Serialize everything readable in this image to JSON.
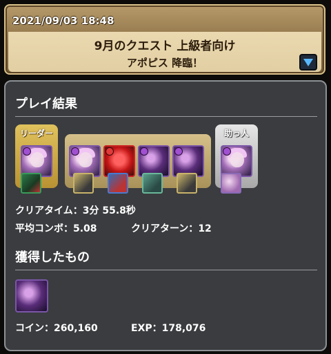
{
  "banner": {
    "datetime": "2021/09/03 18:48",
    "title": "9月のクエスト 上級者向け",
    "subtitle": "アポピス 降臨！"
  },
  "result": {
    "heading": "プレイ結果",
    "team": {
      "leader_label": "リーダー",
      "helper_label": "助っ人"
    },
    "clear_time_label": "クリアタイム：",
    "clear_time": "3分 55.8秒",
    "avg_combo_label": "平均コンボ：",
    "avg_combo": "5.08",
    "clear_turns_label": "クリアターン：",
    "clear_turns": "12"
  },
  "rewards": {
    "heading": "獲得したもの",
    "coin_label": "コイン：",
    "coin": "260,160",
    "exp_label": "EXP：",
    "exp": "178,076"
  },
  "colors": {
    "banner_gold": "#b69a6a",
    "panel_bg": "#3a3c3f",
    "leader_gold": "#e0c25d",
    "dropdown_arrow": "#58b8ff"
  }
}
